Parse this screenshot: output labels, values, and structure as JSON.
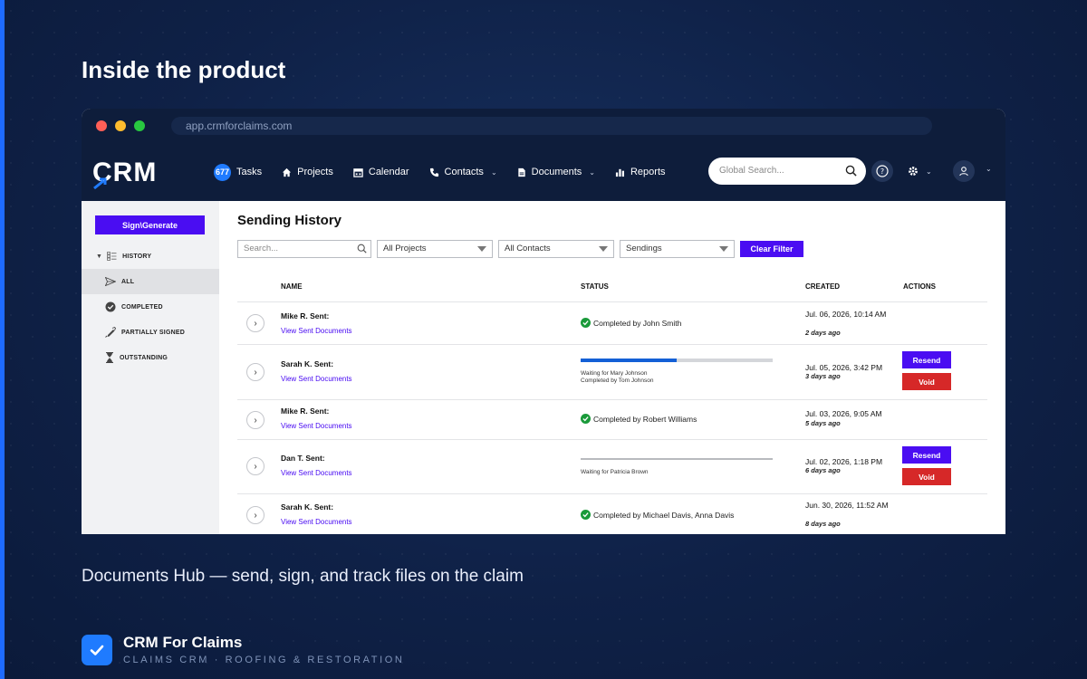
{
  "slide": {
    "headline": "Inside the product",
    "caption": "Documents Hub — send, sign, and track files on the claim",
    "brand_name": "CRM For Claims",
    "brand_tagline": "CLAIMS CRM · ROOFING & RESTORATION"
  },
  "browser": {
    "url": "app.crmforclaims.com"
  },
  "nav": {
    "logo": "CRM",
    "tasks_count": "677",
    "tasks": "Tasks",
    "projects": "Projects",
    "calendar": "Calendar",
    "contacts": "Contacts",
    "documents": "Documents",
    "reports": "Reports",
    "search_placeholder": "Global Search..."
  },
  "sidebar": {
    "sign_button": "Sign\\Generate",
    "history": "HISTORY",
    "all": "ALL",
    "completed": "COMPLETED",
    "partially_signed": "PARTIALLY SIGNED",
    "outstanding": "OUTSTANDING"
  },
  "main": {
    "title": "Sending History",
    "search_placeholder": "Search...",
    "filter_projects": "All Projects",
    "filter_contacts": "All Contacts",
    "filter_type": "Sendings",
    "clear_filter": "Clear Filter",
    "col_name": "NAME",
    "col_status": "STATUS",
    "col_created": "CREATED",
    "col_actions": "ACTIONS",
    "resend_label": "Resend",
    "void_label": "Void",
    "rows": [
      {
        "name": "Mike R. Sent:",
        "link": "View Sent Documents",
        "status": "Completed by John Smith",
        "created": "Jul. 06, 2026, 10:14 AM",
        "ago": "2 days ago"
      },
      {
        "name": "Sarah K. Sent:",
        "link": "View Sent Documents",
        "progress": 0.5,
        "waiting": "Waiting for Mary Johnson",
        "completed_by": "Completed by Tom Johnson",
        "created": "Jul. 05, 2026, 3:42 PM",
        "ago": "3 days ago"
      },
      {
        "name": "Mike R. Sent:",
        "link": "View Sent Documents",
        "status": "Completed by Robert Williams",
        "created": "Jul. 03, 2026, 9:05 AM",
        "ago": "5 days ago"
      },
      {
        "name": "Dan T. Sent:",
        "link": "View Sent Documents",
        "progress": 0,
        "waiting": "Waiting for Patricia Brown",
        "created": "Jul. 02, 2026, 1:18 PM",
        "ago": "6 days ago"
      },
      {
        "name": "Sarah K. Sent:",
        "link": "View Sent Documents",
        "status": "Completed by Michael Davis, Anna Davis",
        "created": "Jun. 30, 2026, 11:52 AM",
        "ago": "8 days ago"
      }
    ]
  }
}
